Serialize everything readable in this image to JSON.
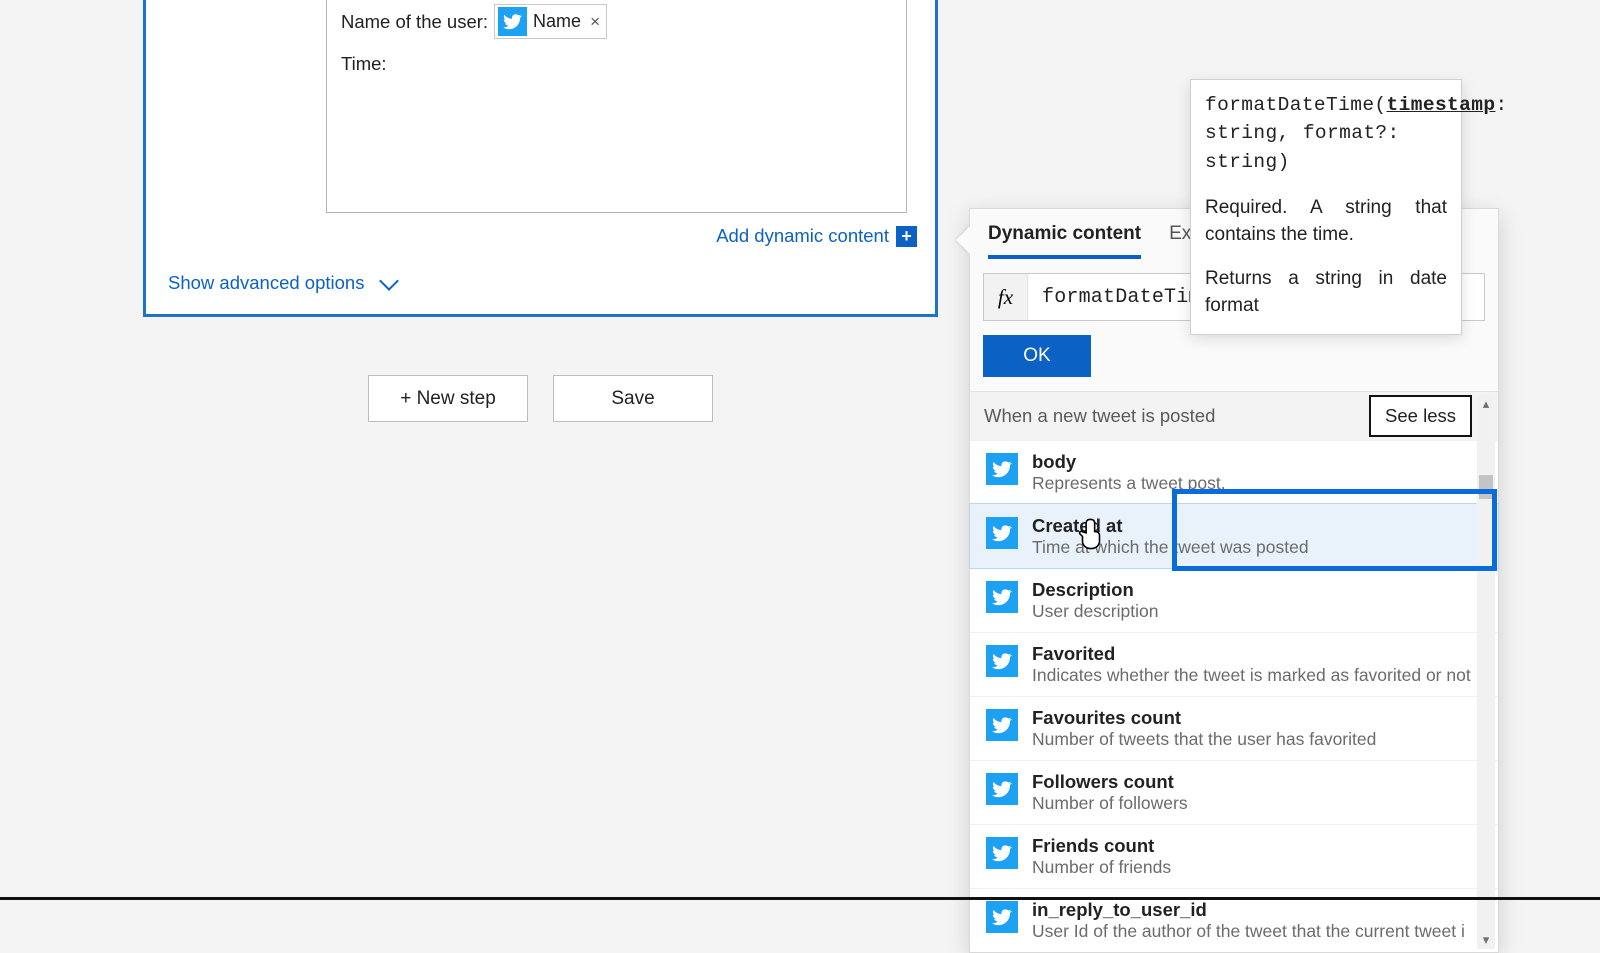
{
  "card": {
    "user_label": "Name of the user:",
    "token_label": "Name",
    "token_remove": "×",
    "time_label": "Time:",
    "add_dynamic": "Add dynamic content",
    "show_advanced": "Show advanced options"
  },
  "buttons": {
    "new_step": "+ New step",
    "save": "Save"
  },
  "dc": {
    "tab_dynamic": "Dynamic content",
    "tab_expression": "Exp",
    "fx": "fx",
    "formula": "formatDateTime(",
    "ok": "OK",
    "section": "When a new tweet is posted",
    "see_less": "See less",
    "items": [
      {
        "name": "body",
        "desc": "Represents a tweet post."
      },
      {
        "name": "Created at",
        "desc": "Time at which the tweet was posted"
      },
      {
        "name": "Description",
        "desc": "User description"
      },
      {
        "name": "Favorited",
        "desc": "Indicates whether the tweet is marked as favorited or not"
      },
      {
        "name": "Favourites count",
        "desc": "Number of tweets that the user has favorited"
      },
      {
        "name": "Followers count",
        "desc": "Number of followers"
      },
      {
        "name": "Friends count",
        "desc": "Number of friends"
      },
      {
        "name": "in_reply_to_user_id",
        "desc": "User Id of the author of the tweet that the current tweet i"
      }
    ],
    "scroll_up": "▴",
    "scroll_down": "▾"
  },
  "tip": {
    "signature_pre": "formatDateTime(",
    "signature_arg": "timestamp",
    "signature_post": ": string, format?: string)",
    "req": "Required. A string that contains the time.",
    "ret": "Returns a string in date format"
  }
}
